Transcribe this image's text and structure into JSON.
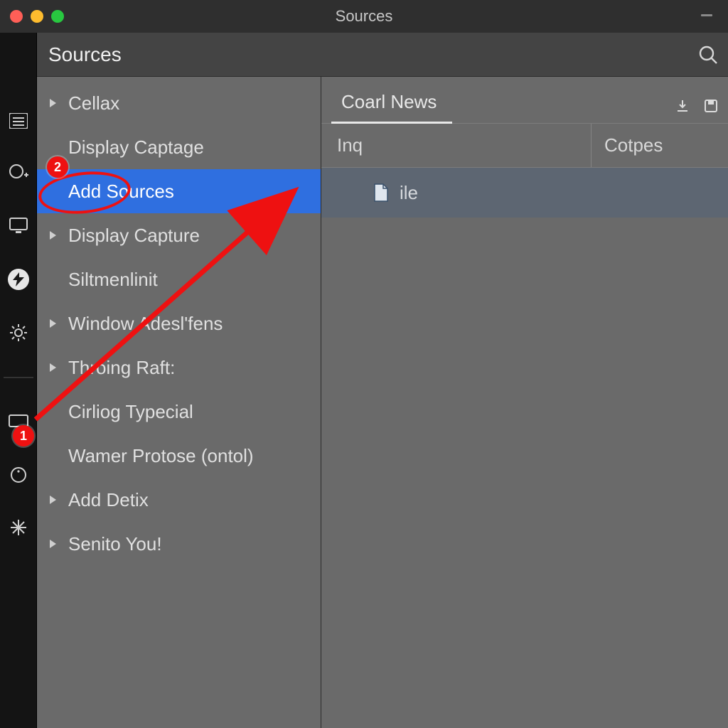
{
  "window": {
    "title": "Sources"
  },
  "header": {
    "title": "Sources"
  },
  "rail_icons": [
    "list-icon",
    "add-icon",
    "monitor-icon",
    "bolt-icon",
    "gear-icon",
    "display-icon",
    "circle-icon",
    "sparkle-icon"
  ],
  "tree": {
    "items": [
      {
        "label": "Cellax",
        "has_children": true
      },
      {
        "label": "Display Captage",
        "has_children": false
      },
      {
        "label": "Add Sources",
        "has_children": false,
        "selected": true
      },
      {
        "label": "Display Capture",
        "has_children": true
      },
      {
        "label": "Siltmenlinit",
        "has_children": false
      },
      {
        "label": "Window Adesl'fens",
        "has_children": true
      },
      {
        "label": "Throing Raft:",
        "has_children": true
      },
      {
        "label": "Cirliog Typecial",
        "has_children": false
      },
      {
        "label": "Wamer Protose (ontol)",
        "has_children": false
      },
      {
        "label": "Add Detix",
        "has_children": true
      },
      {
        "label": "Senito You!",
        "has_children": true
      }
    ]
  },
  "content": {
    "tab_label": "Coarl News",
    "columns": {
      "a": "Inq",
      "b": "Cotpes"
    },
    "row": {
      "label": "ile"
    }
  },
  "annotations": {
    "badge1": "1",
    "badge2": "2"
  }
}
